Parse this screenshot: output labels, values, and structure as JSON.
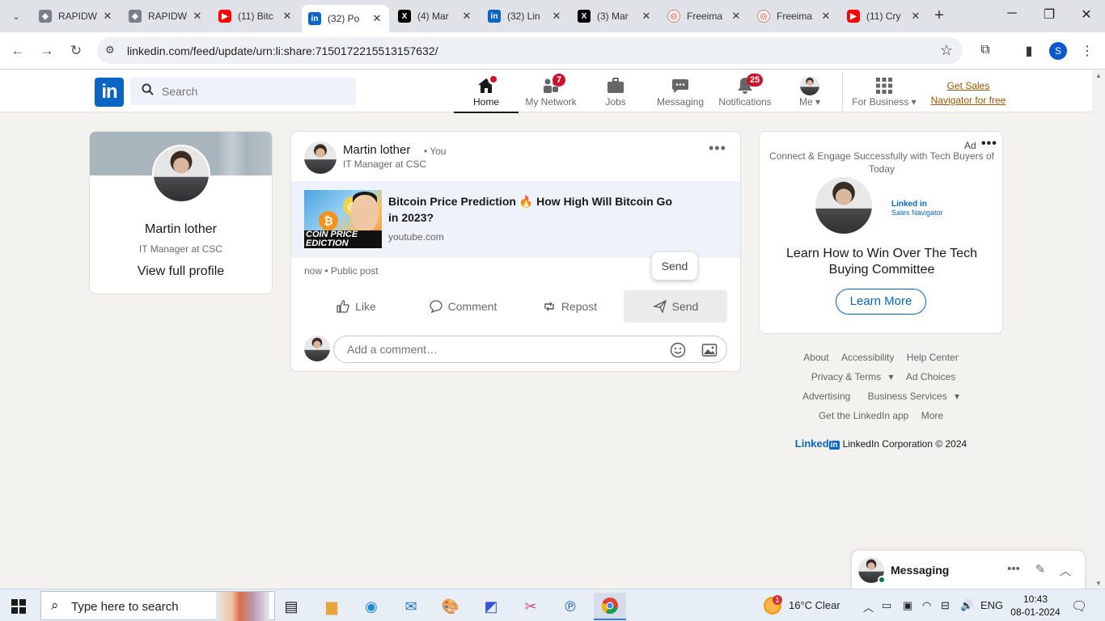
{
  "browser": {
    "tabs": [
      {
        "title": "RAPIDW",
        "icon": "generic-site-icon",
        "active": false
      },
      {
        "title": "RAPIDW",
        "icon": "generic-site-icon",
        "active": false
      },
      {
        "title": "(11) Bitc",
        "icon": "youtube-icon",
        "active": false
      },
      {
        "title": "(32) Po",
        "icon": "linkedin-icon",
        "active": true
      },
      {
        "title": "(4) Mar",
        "icon": "x-icon",
        "active": false
      },
      {
        "title": "(32) Lin",
        "icon": "linkedin-icon",
        "active": false
      },
      {
        "title": "(3) Mar",
        "icon": "x-icon",
        "active": false
      },
      {
        "title": "Freeima",
        "icon": "freeimage-icon",
        "active": false
      },
      {
        "title": "Freeima",
        "icon": "freeimage-icon",
        "active": false
      },
      {
        "title": "(11) Cry",
        "icon": "youtube-icon",
        "active": false
      }
    ],
    "url": "linkedin.com/feed/update/urn:li:share:7150172215513157632/",
    "profile_initial": "S"
  },
  "linkedin": {
    "logo": "in",
    "search_placeholder": "Search",
    "nav": {
      "home": "Home",
      "network": "My Network",
      "network_badge": "7",
      "jobs": "Jobs",
      "messaging": "Messaging",
      "notifications": "Notifications",
      "notifications_badge": "25",
      "me": "Me",
      "for_business": "For Business",
      "sales_link_line1": "Get Sales",
      "sales_link_line2": "Navigator for free"
    },
    "profile": {
      "name": "Martin lother",
      "title": "IT Manager at CSC",
      "link": "View full profile"
    },
    "post": {
      "author": "Martin lother",
      "you_label": "• You",
      "headline": "IT Manager at CSC",
      "link_title": "Bitcoin Price Prediction 🔥 How High Will Bitcoin Go in 2023?",
      "link_source": "youtube.com",
      "thumb_caption_1": "COIN PRICE",
      "thumb_caption_2": "EDICTION",
      "meta": "now • Public post",
      "tooltip": "Send",
      "actions": {
        "like": "Like",
        "comment": "Comment",
        "repost": "Repost",
        "send": "Send"
      },
      "comment_placeholder": "Add a comment…"
    },
    "ad": {
      "label": "Ad",
      "tagline": "Connect & Engage Successfully with Tech Buyers of Today",
      "brand_line1": "Linked in",
      "brand_line2": "Sales Navigator",
      "headline": "Learn How to Win Over The Tech Buying Committee",
      "cta": "Learn More"
    },
    "footer": {
      "about": "About",
      "accessibility": "Accessibility",
      "help": "Help Center",
      "privacy": "Privacy & Terms",
      "ad_choices": "Ad Choices",
      "advertising": "Advertising",
      "business_services": "Business Services",
      "get_app": "Get the LinkedIn app",
      "more": "More",
      "brand": "Linked",
      "brand_in": "in",
      "copyright": "LinkedIn Corporation © 2024"
    },
    "messaging_bar": {
      "title": "Messaging"
    }
  },
  "taskbar": {
    "search_text": "Type here to search",
    "weather_badge": "1",
    "weather": "16°C  Clear",
    "language": "ENG",
    "time": "10:43",
    "date": "08-01-2024"
  },
  "colors": {
    "linkedin_blue": "#0a66c2",
    "badge_red": "#cb112d",
    "sales_link": "#915907"
  }
}
